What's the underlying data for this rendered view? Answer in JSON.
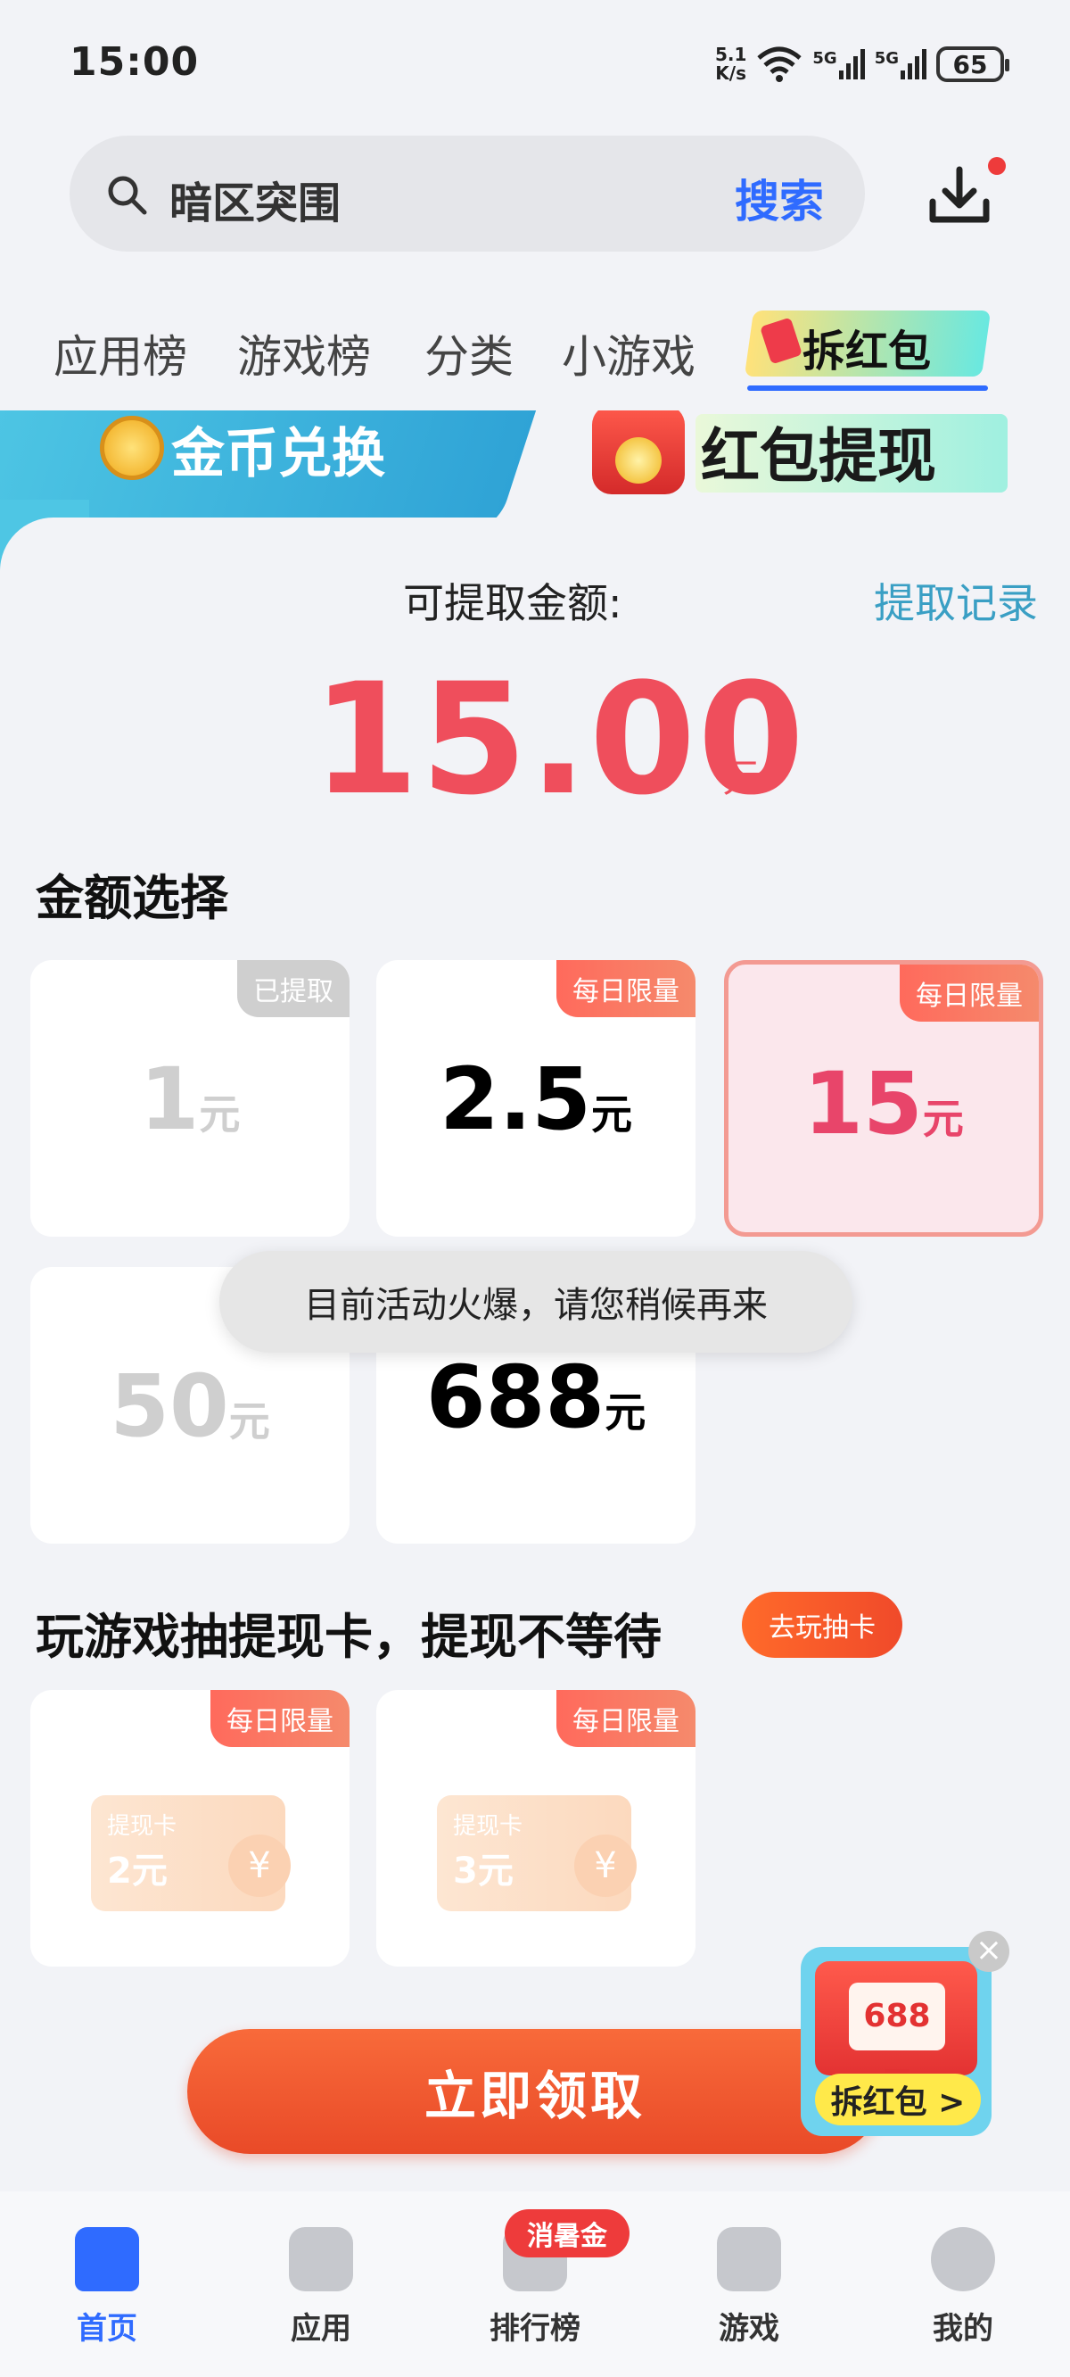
{
  "status_bar": {
    "time": "15:00",
    "net_speed_value": "5.1",
    "net_speed_unit": "K/s",
    "signal_1": "5G",
    "signal_2": "5G",
    "battery": "65"
  },
  "search": {
    "query": "暗区突围",
    "button_label": "搜索"
  },
  "tabs": [
    {
      "label": "应用榜"
    },
    {
      "label": "游戏榜"
    },
    {
      "label": "分类"
    },
    {
      "label": "小游戏"
    },
    {
      "label": "拆红包",
      "active": true
    }
  ],
  "banner": {
    "left_label": "金币兑换",
    "right_label": "红包提现"
  },
  "withdraw": {
    "label": "可提取金额:",
    "record_link": "提取记录",
    "amount": "15.00",
    "unit": "元"
  },
  "amount_section": {
    "title": "金额选择",
    "options": [
      {
        "value": "1",
        "unit": "元",
        "badge": "已提取",
        "state": "withdrawn"
      },
      {
        "value": "2.5",
        "unit": "元",
        "badge": "每日限量",
        "state": "available"
      },
      {
        "value": "15",
        "unit": "元",
        "badge": "每日限量",
        "state": "selected"
      },
      {
        "value": "50",
        "unit": "元",
        "badge": "",
        "state": "disabled"
      },
      {
        "value": "688",
        "unit": "元",
        "badge": "",
        "state": "available"
      }
    ]
  },
  "toast": "目前活动火爆，请您稍候再来",
  "cards_section": {
    "title": "玩游戏抽提现卡，提现不等待",
    "play_button": "去玩抽卡",
    "cards": [
      {
        "badge": "每日限量",
        "label": "提现卡",
        "value": "2元",
        "coin": "¥"
      },
      {
        "badge": "每日限量",
        "label": "提现卡",
        "value": "3元",
        "coin": "¥"
      }
    ]
  },
  "claim_button": "立即领取",
  "floating_promo": {
    "amount": "688元",
    "cta": "拆红包 >",
    "close": "×"
  },
  "bottom_nav": [
    {
      "label": "首页",
      "active": true,
      "icon": "home-icon"
    },
    {
      "label": "应用",
      "icon": "bag-icon"
    },
    {
      "label": "排行榜",
      "icon": "ranking-icon",
      "badge": "消暑金"
    },
    {
      "label": "游戏",
      "icon": "gamepad-icon"
    },
    {
      "label": "我的",
      "icon": "user-icon"
    }
  ],
  "colors": {
    "accent_blue": "#2f6bff",
    "amount_red": "#ef4e5c",
    "badge_orange": "#ff6a5c"
  }
}
